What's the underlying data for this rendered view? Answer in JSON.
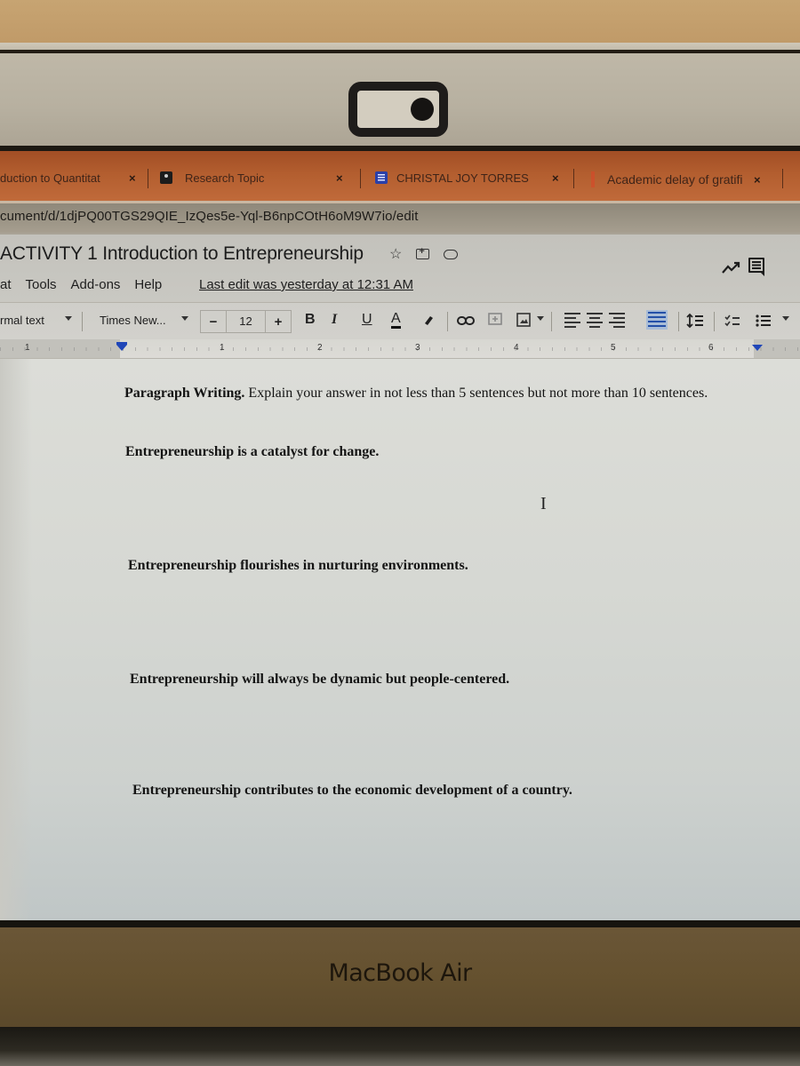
{
  "hardware": {
    "brand_label": "MacBook Air"
  },
  "browser": {
    "tabs": [
      {
        "label": "duction to Quantitat",
        "icon": "document-icon",
        "close": "×"
      },
      {
        "label": "Research Topic",
        "icon": "classroom-icon",
        "close": "×"
      },
      {
        "label": "CHRISTAL JOY TORRES",
        "icon": "google-docs-icon",
        "close": "×"
      },
      {
        "label": "Academic delay of gratifi",
        "icon": "pdf-icon",
        "close": "×"
      }
    ],
    "url": "cument/d/1djPQ00TGS29QIE_IzQes5e-Yql-B6npCOtH6oM9W7io/edit"
  },
  "docs": {
    "title": "ACTIVITY 1 Introduction to Entrepreneurship",
    "title_icons": [
      "star-icon",
      "move-to-folder-icon",
      "cloud-saved-icon"
    ],
    "menu": [
      "at",
      "Tools",
      "Add-ons",
      "Help"
    ],
    "last_edit": "Last edit was yesterday at 12:31 AM",
    "header_icons": [
      "activity-trend-icon",
      "comments-icon"
    ],
    "toolbar": {
      "style": "rmal text",
      "font": "Times New...",
      "font_size": "12",
      "minus": "−",
      "plus": "+",
      "bold": "B",
      "italic": "I",
      "underline": "U",
      "text_color": "A",
      "align_active": "justify"
    },
    "ruler": {
      "numbers": [
        "1",
        "1",
        "2",
        "3",
        "4",
        "5",
        "6"
      ]
    },
    "body": {
      "prompt_bold": "Paragraph Writing.",
      "prompt_rest": " Explain your answer in not less than 5 sentences but not more than 10 sentences.",
      "sentences": [
        "Entrepreneurship is a catalyst for change.",
        "Entrepreneurship flourishes in nurturing environments.",
        "Entrepreneurship will always be dynamic but people-centered.",
        "Entrepreneurship contributes to the economic development of a country."
      ],
      "cursor": "I"
    }
  },
  "colors": {
    "tab_bar": "#b35e2f",
    "justify_active_bg": "#a8bcd6",
    "indent_marker": "#2046b8",
    "docs_icon": "#2a3fa8"
  }
}
